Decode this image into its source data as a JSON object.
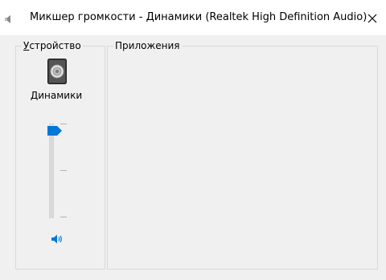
{
  "window": {
    "title": "Микшер громкости - Динамики (Realtek High Definition Audio)",
    "icon": "speaker-icon"
  },
  "device_group": {
    "label_prefix": "",
    "label_underlined": "У",
    "label_rest": "стройство",
    "device_icon": "speaker-device-icon",
    "device_name": "Динамики",
    "volume_level": 0.95,
    "mute_icon": "speaker-volume-icon",
    "accent_color": "#0078d7"
  },
  "apps_group": {
    "label": "Приложения"
  }
}
